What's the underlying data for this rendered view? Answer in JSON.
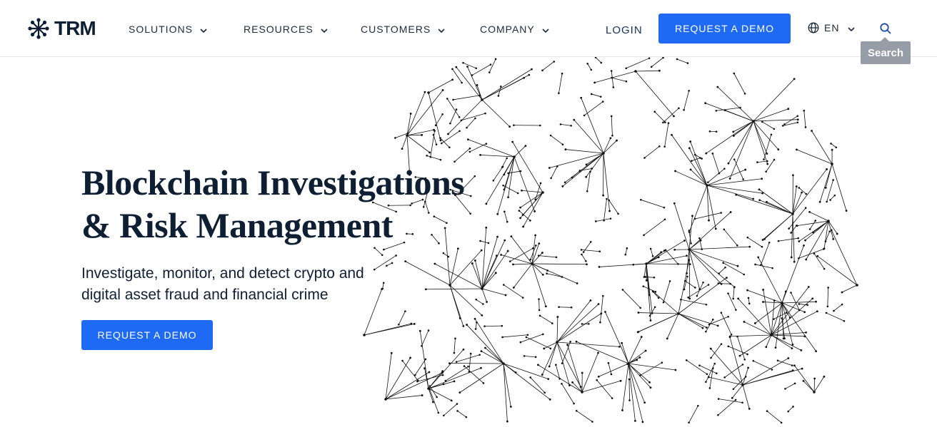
{
  "brand": {
    "name": "TRM",
    "accent": "#1f6af5",
    "text_color": "#0f1f33"
  },
  "nav": {
    "items": [
      {
        "label": "SOLUTIONS",
        "icon": "chevron-down-icon"
      },
      {
        "label": "RESOURCES",
        "icon": "chevron-down-icon"
      },
      {
        "label": "CUSTOMERS",
        "icon": "chevron-down-icon"
      },
      {
        "label": "COMPANY",
        "icon": "chevron-down-icon"
      }
    ],
    "login_label": "LOGIN",
    "demo_label": "REQUEST A DEMO",
    "language": "EN",
    "language_icon": "globe-icon",
    "search_icon": "search-icon",
    "search_tooltip": "Search"
  },
  "hero": {
    "title_line1": "Blockchain Investigations",
    "title_line2": "& Risk Management",
    "subtitle_line1": "Investigate, monitor, and detect crypto and",
    "subtitle_line2": "digital asset fraud and financial crime",
    "cta_label": "REQUEST A DEMO",
    "illustration": "network-graph"
  }
}
